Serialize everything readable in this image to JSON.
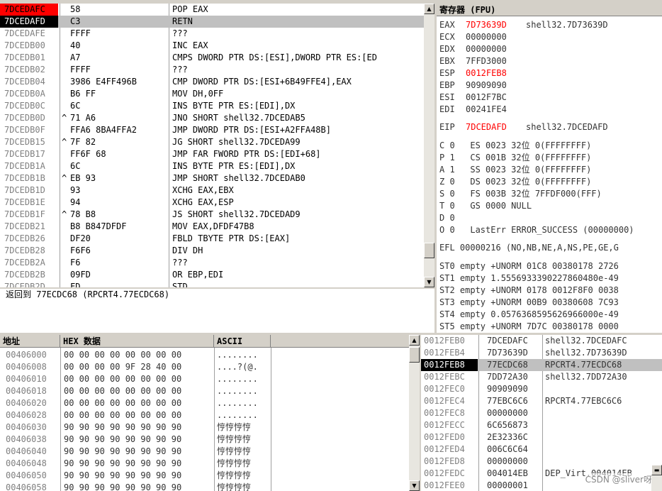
{
  "disasm": {
    "rows": [
      {
        "addr": "7DCEDAFC",
        "jmp": "",
        "hex": "58",
        "instr": "POP EAX",
        "state": "eip-prev"
      },
      {
        "addr": "7DCEDAFD",
        "jmp": "",
        "hex": "C3",
        "instr": "RETN",
        "state": "current"
      },
      {
        "addr": "7DCEDAFE",
        "jmp": "",
        "hex": "FFFF",
        "instr": "???",
        "state": ""
      },
      {
        "addr": "7DCEDB00",
        "jmp": "",
        "hex": "40",
        "instr": "INC EAX",
        "state": ""
      },
      {
        "addr": "7DCEDB01",
        "jmp": "",
        "hex": "A7",
        "instr": "CMPS DWORD PTR DS:[ESI],DWORD PTR ES:[ED",
        "state": ""
      },
      {
        "addr": "7DCEDB02",
        "jmp": "",
        "hex": "FFFF",
        "instr": "???",
        "state": ""
      },
      {
        "addr": "7DCEDB04",
        "jmp": "",
        "hex": "3986 E4FF496B",
        "instr": "CMP DWORD PTR DS:[ESI+6B49FFE4],EAX",
        "state": ""
      },
      {
        "addr": "7DCEDB0A",
        "jmp": "",
        "hex": "B6 FF",
        "instr": "MOV DH,0FF",
        "state": ""
      },
      {
        "addr": "7DCEDB0C",
        "jmp": "",
        "hex": "6C",
        "instr": "INS BYTE PTR ES:[EDI],DX",
        "state": ""
      },
      {
        "addr": "7DCEDB0D",
        "jmp": "^",
        "hex": "71 A6",
        "instr": "JNO SHORT shell32.7DCEDAB5",
        "state": ""
      },
      {
        "addr": "7DCEDB0F",
        "jmp": "",
        "hex": "FFA6 8BA4FFA2",
        "instr": "JMP DWORD PTR DS:[ESI+A2FFA48B]",
        "state": ""
      },
      {
        "addr": "7DCEDB15",
        "jmp": "^",
        "hex": "7F 82",
        "instr": "JG SHORT shell32.7DCEDA99",
        "state": ""
      },
      {
        "addr": "7DCEDB17",
        "jmp": "",
        "hex": "FF6F 68",
        "instr": "JMP FAR FWORD PTR DS:[EDI+68]",
        "state": ""
      },
      {
        "addr": "7DCEDB1A",
        "jmp": "",
        "hex": "6C",
        "instr": "INS BYTE PTR ES:[EDI],DX",
        "state": ""
      },
      {
        "addr": "7DCEDB1B",
        "jmp": "^",
        "hex": "EB 93",
        "instr": "JMP SHORT shell32.7DCEDAB0",
        "state": ""
      },
      {
        "addr": "7DCEDB1D",
        "jmp": "",
        "hex": "93",
        "instr": "XCHG EAX,EBX",
        "state": ""
      },
      {
        "addr": "7DCEDB1E",
        "jmp": "",
        "hex": "94",
        "instr": "XCHG EAX,ESP",
        "state": ""
      },
      {
        "addr": "7DCEDB1F",
        "jmp": "^",
        "hex": "78 B8",
        "instr": "JS SHORT shell32.7DCEDAD9",
        "state": ""
      },
      {
        "addr": "7DCEDB21",
        "jmp": "",
        "hex": "B8 B847DFDF",
        "instr": "MOV EAX,DFDF47B8",
        "state": ""
      },
      {
        "addr": "7DCEDB26",
        "jmp": "",
        "hex": "DF20",
        "instr": "FBLD TBYTE PTR DS:[EAX]",
        "state": ""
      },
      {
        "addr": "7DCEDB28",
        "jmp": "",
        "hex": "F6F6",
        "instr": "DIV DH",
        "state": ""
      },
      {
        "addr": "7DCEDB2A",
        "jmp": "",
        "hex": "F6",
        "instr": "???",
        "state": ""
      },
      {
        "addr": "7DCEDB2B",
        "jmp": "",
        "hex": "09FD",
        "instr": "OR EBP,EDI",
        "state": ""
      },
      {
        "addr": "7DCEDB2D",
        "jmp": "",
        "hex": "FD",
        "instr": "STD",
        "state": ""
      }
    ]
  },
  "info": {
    "text": "返回到 77ECDC68 (RPCRT4.77ECDC68)"
  },
  "registers": {
    "title": "寄存器 (FPU)",
    "gp": [
      {
        "name": "EAX",
        "value": "7D73639D",
        "changed": true,
        "comment": "shell32.7D73639D"
      },
      {
        "name": "ECX",
        "value": "00000000",
        "changed": false,
        "comment": ""
      },
      {
        "name": "EDX",
        "value": "00000000",
        "changed": false,
        "comment": ""
      },
      {
        "name": "EBX",
        "value": "7FFD3000",
        "changed": false,
        "comment": ""
      },
      {
        "name": "ESP",
        "value": "0012FEB8",
        "changed": true,
        "comment": ""
      },
      {
        "name": "EBP",
        "value": "90909090",
        "changed": false,
        "comment": ""
      },
      {
        "name": "ESI",
        "value": "0012F7BC",
        "changed": false,
        "comment": ""
      },
      {
        "name": "EDI",
        "value": "00241FE4",
        "changed": false,
        "comment": ""
      }
    ],
    "eip": {
      "name": "EIP",
      "value": "7DCEDAFD",
      "comment": "shell32.7DCEDAFD"
    },
    "flags": [
      "C 0   ES 0023 32位 0(FFFFFFFF)",
      "P 1   CS 001B 32位 0(FFFFFFFF)",
      "A 1   SS 0023 32位 0(FFFFFFFF)",
      "Z 0   DS 0023 32位 0(FFFFFFFF)",
      "S 0   FS 003B 32位 7FFDF000(FFF)",
      "T 0   GS 0000 NULL",
      "D 0",
      "O 0   LastErr ERROR_SUCCESS (00000000)"
    ],
    "efl": "EFL 00000216 (NO,NB,NE,A,NS,PE,GE,G",
    "fpu": [
      "ST0 empty +UNORM 01C8 00380178 2726",
      "ST1 empty 1.5556933390227860480e-49",
      "ST2 empty +UNORM 0178 0012F8F0 0038",
      "ST3 empty +UNORM 00B9 00380608 7C93",
      "ST4 empty 0.0576368595626966000e-49",
      "ST5 empty +UNORM 7D7C 00380178 0000"
    ]
  },
  "dump": {
    "headers": {
      "addr": "地址",
      "hex": "HEX 数据",
      "ascii": "ASCII"
    },
    "rows": [
      {
        "addr": "00406000",
        "hex": "00 00 00 00 00 00 00 00",
        "ascii": "........"
      },
      {
        "addr": "00406008",
        "hex": "00 00 00 00 9F 28 40 00",
        "ascii": "....?(@."
      },
      {
        "addr": "00406010",
        "hex": "00 00 00 00 00 00 00 00",
        "ascii": "........"
      },
      {
        "addr": "00406018",
        "hex": "00 00 00 00 00 00 00 00",
        "ascii": "........"
      },
      {
        "addr": "00406020",
        "hex": "00 00 00 00 00 00 00 00",
        "ascii": "........"
      },
      {
        "addr": "00406028",
        "hex": "00 00 00 00 00 00 00 00",
        "ascii": "........"
      },
      {
        "addr": "00406030",
        "hex": "90 90 90 90 90 90 90 90",
        "ascii": "悙悙悙悙"
      },
      {
        "addr": "00406038",
        "hex": "90 90 90 90 90 90 90 90",
        "ascii": "悙悙悙悙"
      },
      {
        "addr": "00406040",
        "hex": "90 90 90 90 90 90 90 90",
        "ascii": "悙悙悙悙"
      },
      {
        "addr": "00406048",
        "hex": "90 90 90 90 90 90 90 90",
        "ascii": "悙悙悙悙"
      },
      {
        "addr": "00406050",
        "hex": "90 90 90 90 90 90 90 90",
        "ascii": "悙悙悙悙"
      },
      {
        "addr": "00406058",
        "hex": "90 90 90 90 90 90 90 90",
        "ascii": "悙悙悙悙"
      }
    ]
  },
  "stack": {
    "rows": [
      {
        "addr": "0012FEB0",
        "value": "7DCEDAFC",
        "comment": "shell32.7DCEDAFC",
        "selected": false
      },
      {
        "addr": "0012FEB4",
        "value": "7D73639D",
        "comment": "shell32.7D73639D",
        "selected": false
      },
      {
        "addr": "0012FEB8",
        "value": "77ECDC68",
        "comment": "RPCRT4.77ECDC68",
        "selected": true
      },
      {
        "addr": "0012FEBC",
        "value": "7DD72A30",
        "comment": "shell32.7DD72A30",
        "selected": false
      },
      {
        "addr": "0012FEC0",
        "value": "90909090",
        "comment": "",
        "selected": false
      },
      {
        "addr": "0012FEC4",
        "value": "77EBC6C6",
        "comment": "RPCRT4.77EBC6C6",
        "selected": false
      },
      {
        "addr": "0012FEC8",
        "value": "00000000",
        "comment": "",
        "selected": false
      },
      {
        "addr": "0012FECC",
        "value": "6C656873",
        "comment": "",
        "selected": false
      },
      {
        "addr": "0012FED0",
        "value": "2E32336C",
        "comment": "",
        "selected": false
      },
      {
        "addr": "0012FED4",
        "value": "006C6C64",
        "comment": "",
        "selected": false
      },
      {
        "addr": "0012FED8",
        "value": "00000000",
        "comment": "",
        "selected": false
      },
      {
        "addr": "0012FEDC",
        "value": "004014EB",
        "comment": "DEP_Virt.004014EB",
        "selected": false
      },
      {
        "addr": "0012FEE0",
        "value": "00000001",
        "comment": "",
        "selected": false
      }
    ]
  },
  "watermark": "CSDN @sliver呀"
}
